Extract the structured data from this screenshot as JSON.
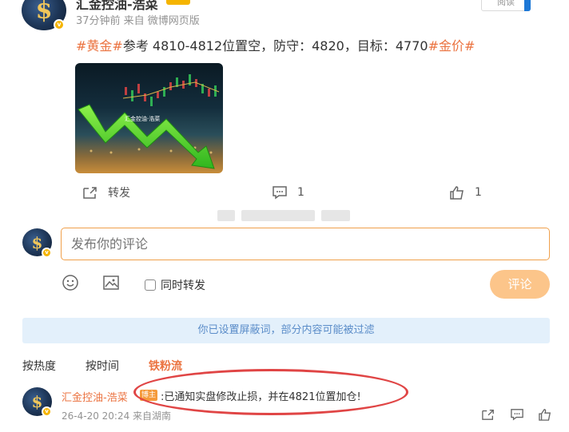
{
  "post": {
    "author": "汇金控油-浩菜",
    "meta": "37分钟前  来自 微博网页版",
    "follow_label": "阅读",
    "text": {
      "tag1": "#黄金#",
      "body": "参考 4810-4812位置空，防守：4820，目标：4770",
      "tag2": "#金价#"
    },
    "image_watermark": "汇金控油·浩菜",
    "actions": {
      "repost_label": "转发",
      "comment_count": "1",
      "like_count": "1"
    }
  },
  "comment_box": {
    "placeholder": "发布你的评论",
    "repost_checkbox_label": "同时转发",
    "submit_label": "评论"
  },
  "notice": "你已设置屏蔽词，部分内容可能被过滤",
  "sort_tabs": [
    {
      "label": "按热度"
    },
    {
      "label": "按时间"
    },
    {
      "label": "铁粉流"
    }
  ],
  "comment": {
    "author": "汇金控油-浩菜",
    "badge": "博主",
    "text": ":已通知实盘修改止损，并在4821位置加仓!",
    "meta": "26-4-20 20:24  来自湖南"
  },
  "colors": {
    "accent": "#eb7340",
    "input_border": "#f0a04b",
    "submit_disabled": "#fcc58a",
    "notice_bg": "#e3f0fb",
    "highlight": "#e04545"
  }
}
